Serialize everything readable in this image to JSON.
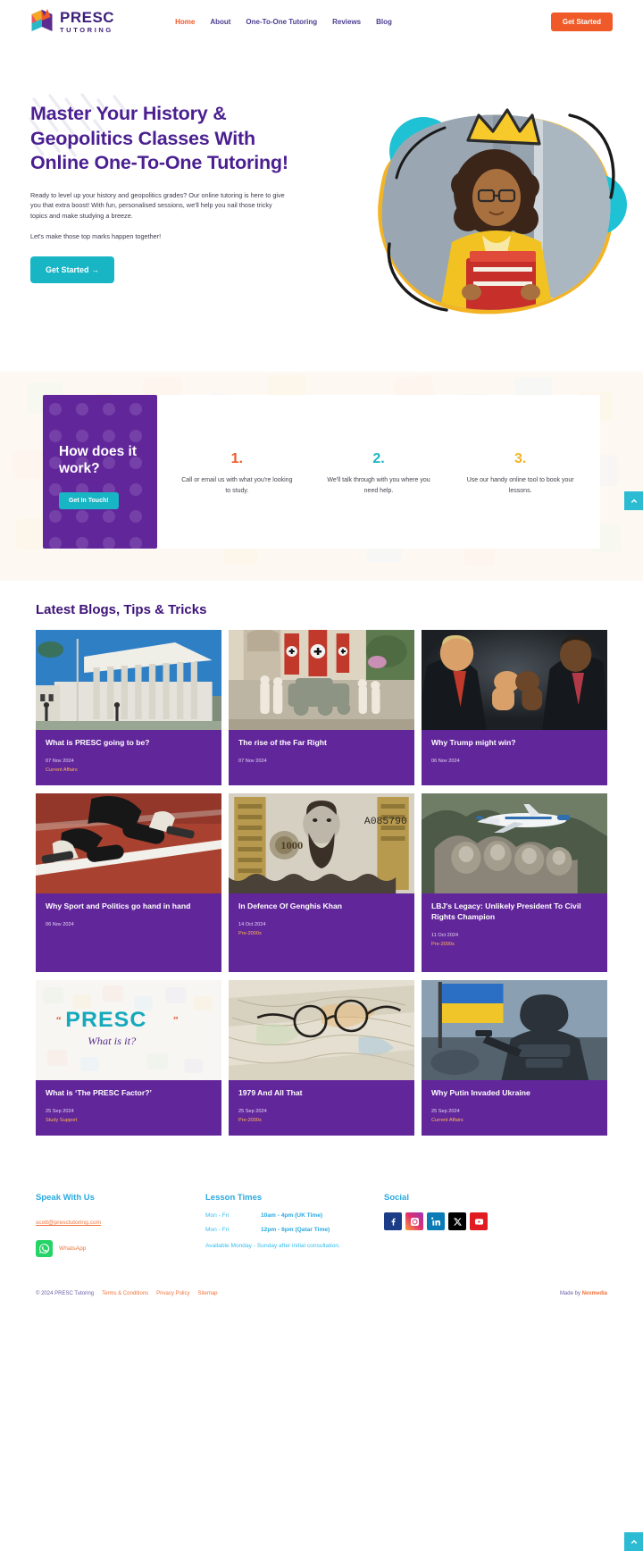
{
  "header": {
    "logo_main": "PRESC",
    "logo_sub": "TUTORING",
    "logo_icon": "book-shield-logo-icon",
    "nav": [
      {
        "label": "Home",
        "active": true
      },
      {
        "label": "About",
        "active": false
      },
      {
        "label": "One-To-One Tutoring",
        "active": false
      },
      {
        "label": "Reviews",
        "active": false
      },
      {
        "label": "Blog",
        "active": false
      }
    ],
    "cta_label": "Get Started"
  },
  "hero": {
    "title": "Master Your History & Geopolitics Classes With Online One-To-One Tutoring!",
    "paragraph": "Ready to level up your history and geopolitics grades? Our online tutoring is here to give you that extra boost! With fun, personalised sessions, we'll help you nail those tricky topics and make studying a breeze.",
    "paragraph2": "Let's make those top marks happen together!",
    "button_label": "Get Started  →",
    "image_alt": "student-with-books-photo"
  },
  "how_it_works": {
    "heading": "How does it work?",
    "button_label": "Get In Touch!",
    "steps": [
      {
        "num": "1.",
        "color": "#f05a28",
        "text": "Call or email us with what you're looking to study."
      },
      {
        "num": "2.",
        "color": "#18b5c4",
        "text": "We'll talk through with you where you need help."
      },
      {
        "num": "3.",
        "color": "#f5b324",
        "text": "Use our handy online tool to book your lessons."
      }
    ]
  },
  "blogs": {
    "heading": "Latest Blogs, Tips & Tricks",
    "rows": [
      [
        {
          "title": "What is PRESC going to be?",
          "date": "07 Nov 2024",
          "category": "Current Affairs",
          "image": "supreme-court-building-photo"
        },
        {
          "title": "The rise of the Far Right",
          "date": "07 Nov 2024",
          "category": "",
          "image": "far-right-rally-photo"
        },
        {
          "title": "Why Trump might win?",
          "date": "06 Nov 2024",
          "category": "",
          "image": "trump-obama-fist-bump-photo"
        }
      ],
      [
        {
          "title": "Why Sport and Politics go hand in hand",
          "date": "06 Nov 2024",
          "category": "",
          "image": "sprinter-starting-blocks-photo"
        },
        {
          "title": "In Defence Of Genghis Khan",
          "date": "14 Oct 2024",
          "category": "Pre-2000s",
          "image": "mongolian-banknote-photo"
        },
        {
          "title": "LBJ's Legacy: Unlikely President To Civil Rights Champion",
          "date": "11 Oct 2024",
          "category": "Pre-2000s",
          "image": "air-force-one-mount-rushmore-photo"
        }
      ],
      [
        {
          "title": "What is ‘The PRESC Factor?’",
          "date": "25 Sep 2024",
          "category": "Study Support",
          "image": "presc-what-is-it-graphic"
        },
        {
          "title": "1979 And All That",
          "date": "25 Sep 2024",
          "category": "Pre-2000s",
          "image": "map-and-glasses-photo"
        },
        {
          "title": "Why Putin Invaded Ukraine",
          "date": "25 Sep 2024",
          "category": "Current Affairs",
          "image": "soldier-ukraine-flag-photo"
        }
      ]
    ]
  },
  "footer": {
    "speak": {
      "heading": "Speak With Us",
      "email": "scott@presctutoring.com",
      "whatsapp_label": "WhatsApp"
    },
    "lessons": {
      "heading": "Lesson Times",
      "rows": [
        {
          "day": "Mon - Fri",
          "time": "10am - 4pm (UK Time)"
        },
        {
          "day": "Mon - Fri",
          "time": "12pm - 6pm (Qatar Time)"
        }
      ],
      "note": "Available Monday - Sunday after initial consultation."
    },
    "social": {
      "heading": "Social",
      "items": [
        {
          "name": "facebook",
          "label": "Facebook"
        },
        {
          "name": "instagram",
          "label": "Instagram"
        },
        {
          "name": "linkedin",
          "label": "LinkedIn"
        },
        {
          "name": "x",
          "label": "X"
        },
        {
          "name": "youtube",
          "label": "YouTube"
        }
      ]
    }
  },
  "copyright": {
    "text": "© 2024 PRESC Tutoring",
    "links": [
      "Terms & Conditions",
      "Privacy Policy",
      "Sitemap"
    ],
    "made_by_prefix": "Made by ",
    "made_by": "Nexmedia"
  },
  "colors": {
    "purple": "#62269b",
    "deep_purple": "#4b1f91",
    "orange": "#f05a28",
    "teal": "#18b5c4",
    "yellow": "#f5b324",
    "blue": "#29a9e0"
  }
}
